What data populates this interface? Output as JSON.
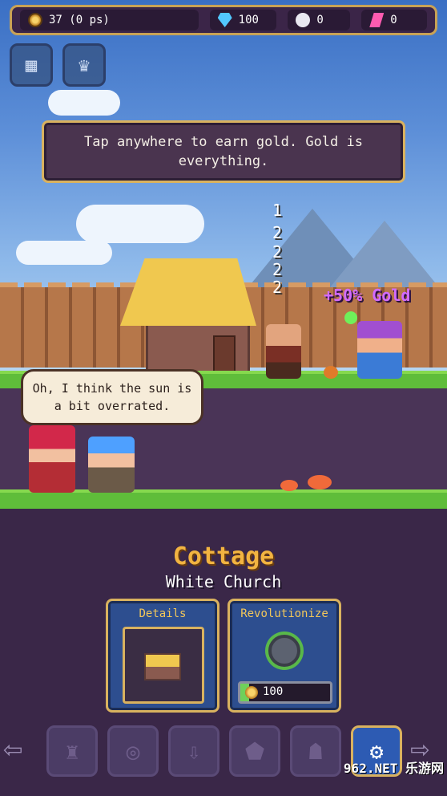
{
  "resources": {
    "gold": "37 (0 ps)",
    "gems": "100",
    "skulls": "0",
    "pink": "0"
  },
  "tutorial": {
    "text": "Tap anywhere to earn gold. Gold is everything."
  },
  "floating_numbers": [
    "1",
    "2",
    "2",
    "2",
    "2"
  ],
  "bonus": "+50% Gold",
  "speech": "Oh, I think the sun is a bit overrated.",
  "building": {
    "name": "Cottage",
    "subtitle": "White Church"
  },
  "cards": {
    "details_label": "Details",
    "revolutionize_label": "Revolutionize",
    "revolutionize_cost": "100",
    "revolutionize_progress": 0.1
  },
  "nav": {
    "icons": [
      "arrow-left-icon",
      "trophy-icon",
      "compass-icon",
      "upgrade-icon",
      "shield-icon",
      "cat-icon",
      "gear-icon",
      "arrow-right-icon"
    ]
  },
  "watermark": "962.NET 乐游网",
  "colors": {
    "gold_text": "#f2b441",
    "bonus_text": "#d36bff",
    "frame": "#d9b25f"
  }
}
